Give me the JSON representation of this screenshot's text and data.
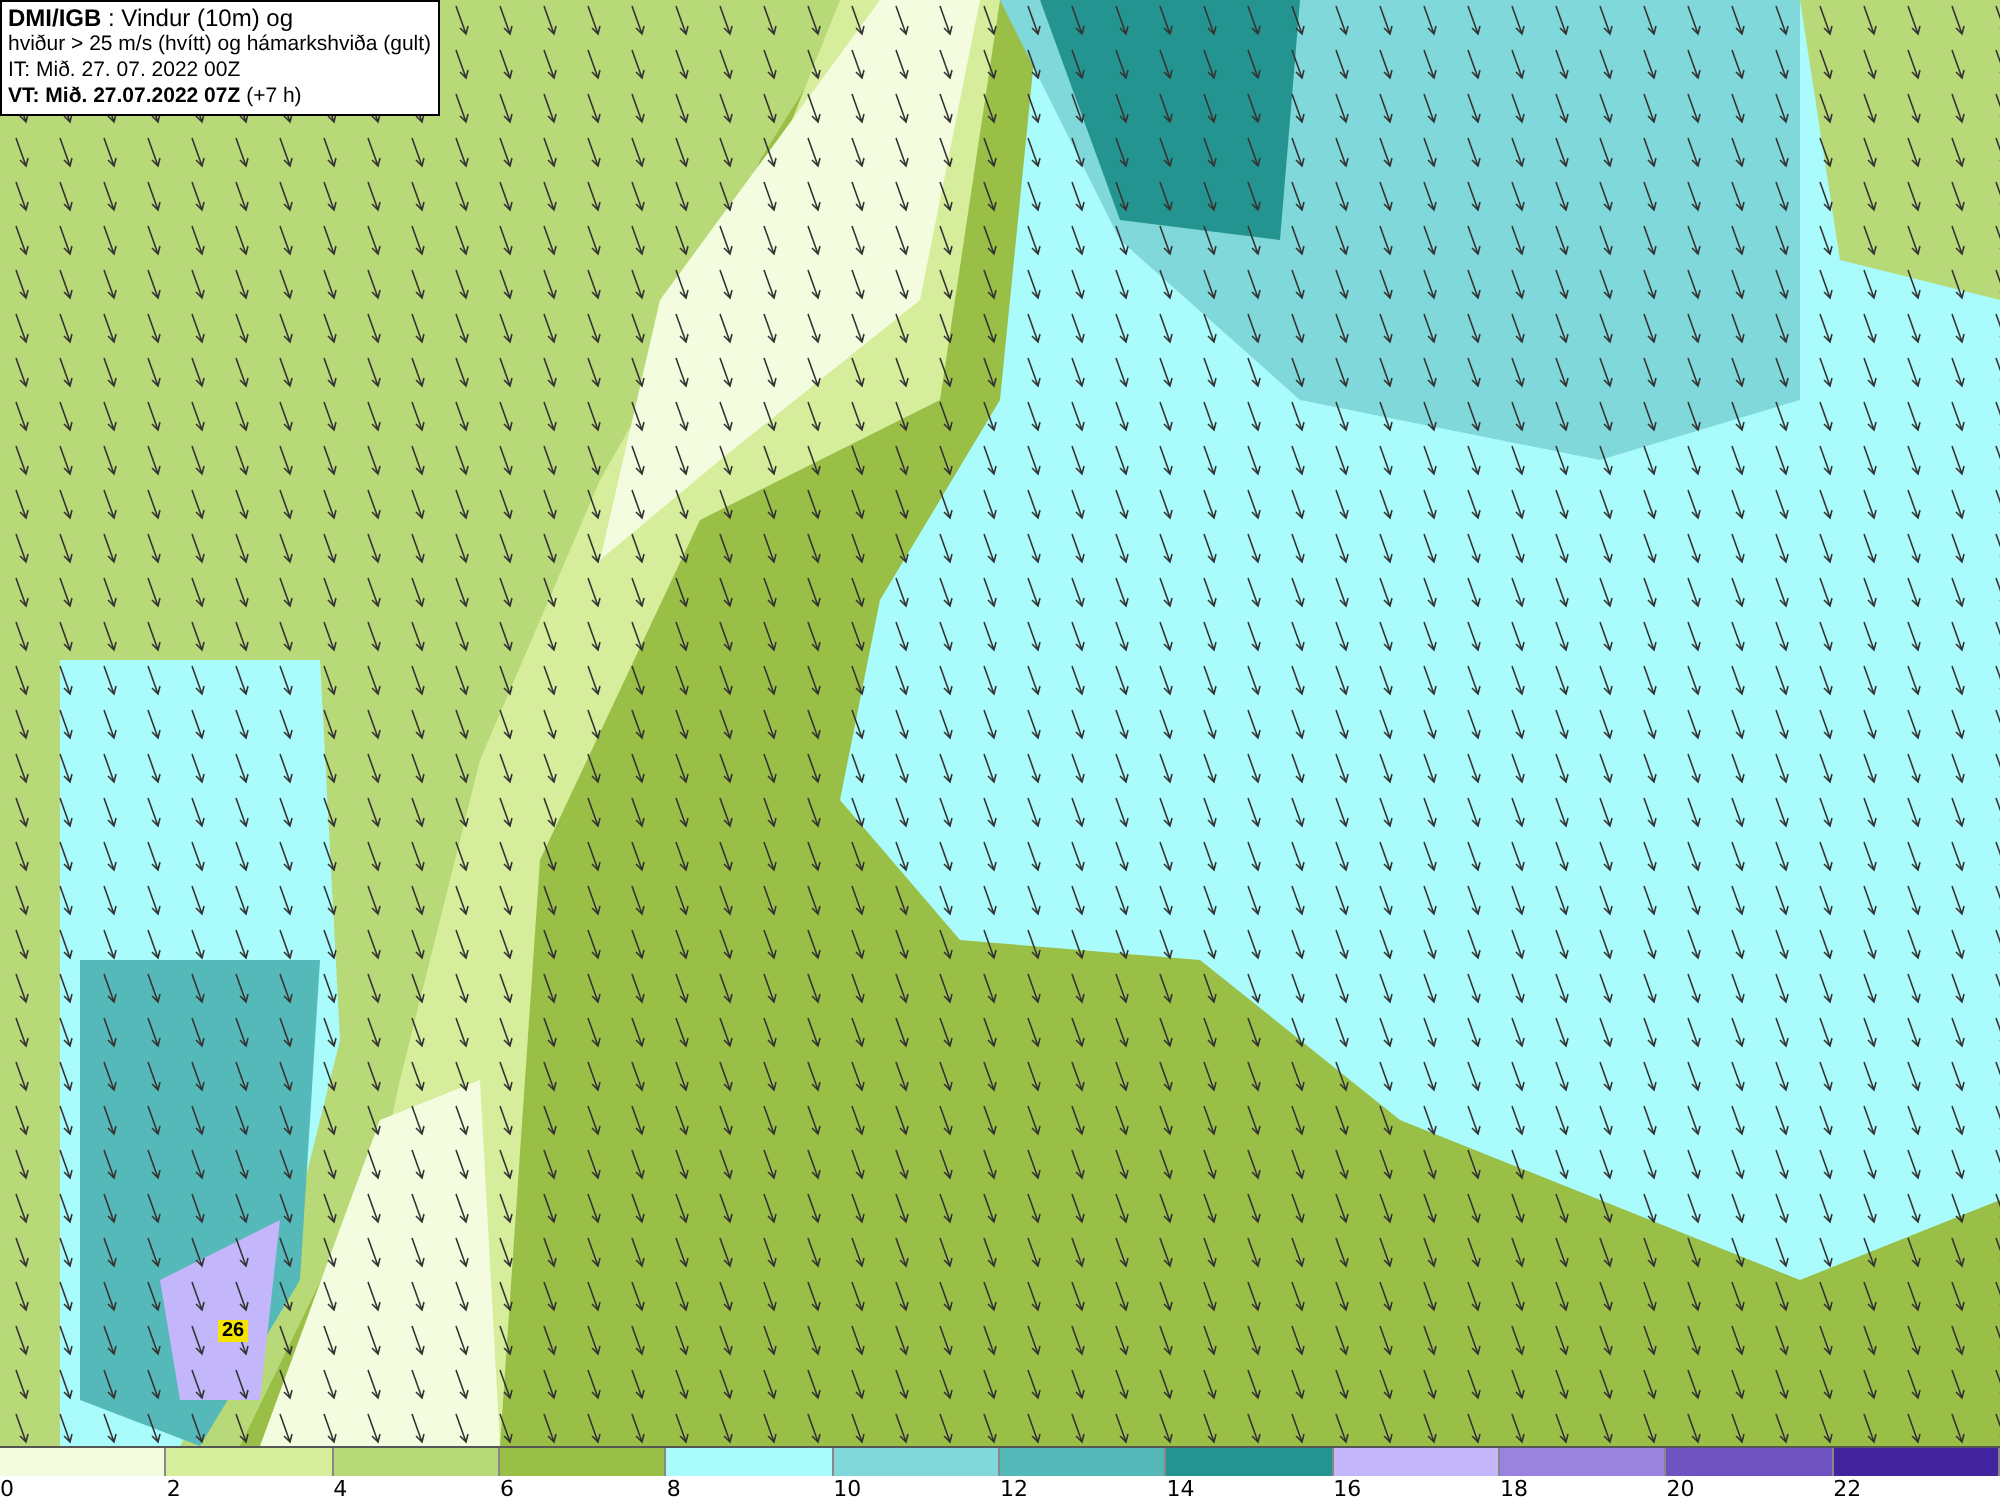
{
  "info_box": {
    "lines": [
      "**DMI/IGB** : Vindur (10m) og",
      "hviður > 25 m/s (hvítt) og hámarkshviða (gult)",
      "IT: Mið. 27. 07. 2022 00Z",
      "**VT: Mið. 27.07.2022 07Z** (+7 h)"
    ]
  },
  "map": {
    "max_gust_label": "26"
  },
  "colorbar": [
    {
      "label": "0",
      "color": "#f4fce0"
    },
    {
      "label": "2",
      "color": "#d6ee9c"
    },
    {
      "label": "4",
      "color": "#b8d977"
    },
    {
      "label": "6",
      "color": "#99bf46"
    },
    {
      "label": "8",
      "color": "#aafcfc"
    },
    {
      "label": "10",
      "color": "#80d8da"
    },
    {
      "label": "12",
      "color": "#55b9b9"
    },
    {
      "label": "14",
      "color": "#249490"
    },
    {
      "label": "16",
      "color": "#c3b6fb"
    },
    {
      "label": "18",
      "color": "#9883de"
    },
    {
      "label": "20",
      "color": "#6f53c1"
    },
    {
      "label": "22",
      "color": "#42249f"
    }
  ]
}
